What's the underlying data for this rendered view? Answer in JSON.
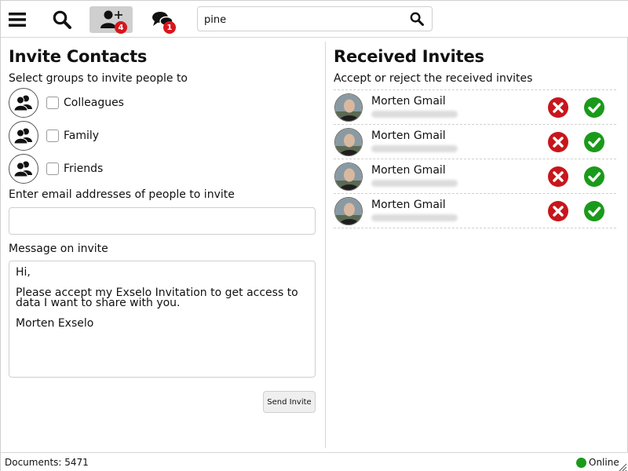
{
  "toolbar": {
    "menu_icon": "hamburger-menu-icon",
    "search_icon": "magnifier-icon",
    "invites_badge": "4",
    "messages_badge": "1",
    "search": {
      "value": "pine"
    }
  },
  "invite_contacts": {
    "title": "Invite Contacts",
    "groups_label": "Select groups to invite people to",
    "groups": [
      {
        "label": "Colleagues",
        "checked": false
      },
      {
        "label": "Family",
        "checked": false
      },
      {
        "label": "Friends",
        "checked": false
      }
    ],
    "email_label": "Enter email addresses of people to invite",
    "email_value": "",
    "message_label": "Message on invite",
    "message_lines": [
      "Hi,",
      "Please accept my Exselo Invitation to get access to data I want to share with you.",
      "Morten Exselo"
    ],
    "send_button": "Send Invite"
  },
  "received_invites": {
    "title": "Received Invites",
    "subtitle": "Accept or reject the received invites",
    "items": [
      {
        "name": "Morten Gmail"
      },
      {
        "name": "Morten Gmail"
      },
      {
        "name": "Morten Gmail"
      },
      {
        "name": "Morten Gmail"
      }
    ]
  },
  "status_bar": {
    "documents": "Documents: 5471",
    "online": "Online"
  },
  "colors": {
    "badge": "#d9161c",
    "reject": "#c8161b",
    "accept": "#1a9a1a",
    "online": "#1a9a1a"
  }
}
